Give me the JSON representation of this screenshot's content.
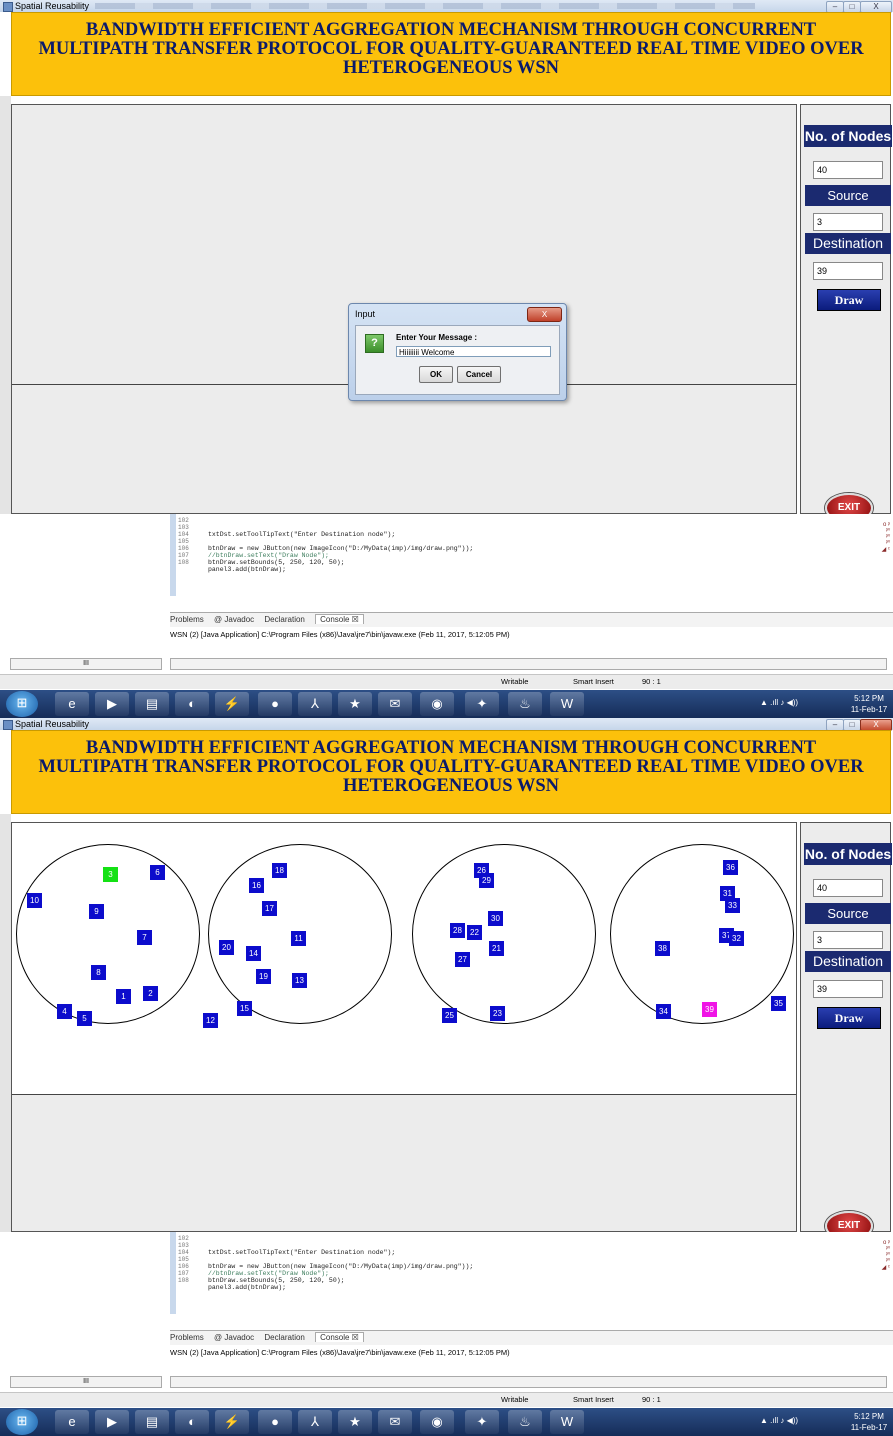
{
  "window": {
    "title": "Spatial Reusability",
    "min_label": "–",
    "max_label": "□",
    "close_label": "X"
  },
  "header": {
    "line1": "BANDWIDTH EFFICIENT AGGREGATION MECHANISM THROUGH CONCURRENT",
    "line2": "MULTIPATH TRANSFER PROTOCOL FOR QUALITY-GUARANTEED REAL TIME VIDEO OVER",
    "line3": "HETEROGENEOUS WSN"
  },
  "side": {
    "nodes_label": "No. of Nodes",
    "nodes_value": "40",
    "source_label": "Source",
    "source_value": "3",
    "dest_label": "Destination",
    "dest_value": "39",
    "draw_label": "Draw",
    "exit_label": "EXIT"
  },
  "dialog": {
    "title": "Input",
    "close": "X",
    "icon": "?",
    "prompt": "Enter Your Message :",
    "value": "Hiiiiiiii Welcome",
    "ok": "OK",
    "cancel": "Cancel"
  },
  "network": {
    "source_node": 3,
    "destination_node": 39,
    "nodes": [
      "3",
      "6",
      "10",
      "9",
      "7",
      "8",
      "1",
      "2",
      "4",
      "5",
      "18",
      "16",
      "17",
      "11",
      "20",
      "14",
      "19",
      "13",
      "15",
      "12",
      "26",
      "29",
      "30",
      "28",
      "22",
      "21",
      "27",
      "25",
      "23",
      "36",
      "31",
      "33",
      "37",
      "32",
      "38",
      "34",
      "39",
      "35"
    ]
  },
  "ide": {
    "line_numbers": [
      "102",
      "103",
      "104",
      "105",
      "106",
      "107",
      "108"
    ],
    "code": [
      "txtDst.setToolTipText(\"Enter Destination node\");",
      "",
      "btnDraw = new JButton(new ImageIcon(\"D:/MyData(imp)/img/draw.png\"));",
      "//btnDraw.setText(\"Draw Node\");",
      "btnDraw.setBounds(5, 250, 120, 50);",
      "panel3.add(btnDraw);",
      ""
    ],
    "tabs": [
      "Problems",
      "@ Javadoc",
      "Declaration",
      "Console ☒"
    ],
    "console": "WSN (2) [Java Application] C:\\Program Files (x86)\\Java\\jre7\\bin\\javaw.exe (Feb 11, 2017, 5:12:05 PM)",
    "status_writable": "Writable",
    "status_insert": "Smart Insert",
    "status_pos": "90 : 1",
    "scroll_mark": "III"
  },
  "taskbar": {
    "time": "5:12 PM",
    "date": "11-Feb-17",
    "tray": "▲ .ıll ♪ ◀))"
  }
}
